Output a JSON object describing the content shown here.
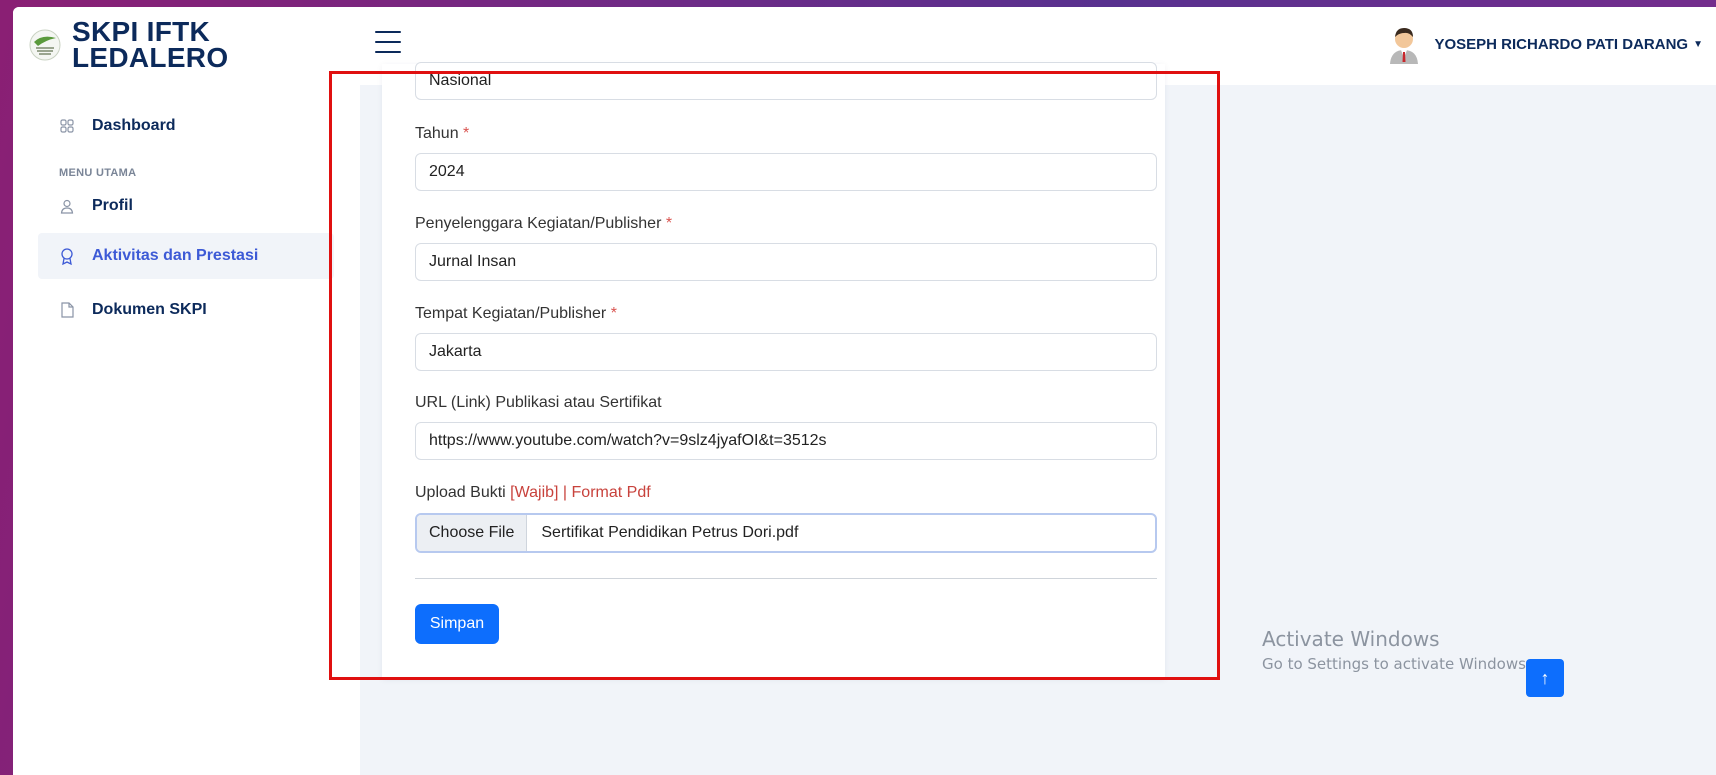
{
  "brand": {
    "title": "SKPI IFTK LEDALERO"
  },
  "user": {
    "name": "YOSEPH RICHARDO PATI DARANG"
  },
  "sidebar": {
    "dashboard": "Dashboard",
    "section_label": "MENU UTAMA",
    "items": [
      {
        "label": "Profil",
        "icon": "user-icon",
        "active": false
      },
      {
        "label": "Aktivitas dan Prestasi",
        "icon": "award-icon",
        "active": true
      },
      {
        "label": "Dokumen SKPI",
        "icon": "document-icon",
        "active": false
      }
    ]
  },
  "form": {
    "tingkat_value": "Nasional",
    "tahun": {
      "label": "Tahun",
      "required_mark": "*",
      "value": "2024"
    },
    "penyelenggara": {
      "label": "Penyelenggara Kegiatan/Publisher",
      "required_mark": "*",
      "value": "Jurnal Insan"
    },
    "tempat": {
      "label": "Tempat Kegiatan/Publisher",
      "required_mark": "*",
      "value": "Jakarta"
    },
    "url": {
      "label": "URL (Link) Publikasi atau Sertifikat",
      "value": "https://www.youtube.com/watch?v=9slz4jyafOI&t=3512s"
    },
    "upload": {
      "label": "Upload Bukti",
      "note": "[Wajib] | Format Pdf",
      "button": "Choose File",
      "file_name": "Sertifikat Pendidikan Petrus Dori.pdf"
    },
    "submit": "Simpan"
  },
  "watermark": {
    "title": "Activate Windows",
    "subtitle": "Go to Settings to activate Windows."
  },
  "scroll_top": "↑",
  "colors": {
    "primary": "#0d6efd",
    "brand": "#0c2a5b",
    "highlight": "#e01010",
    "required": "#d9534f"
  }
}
